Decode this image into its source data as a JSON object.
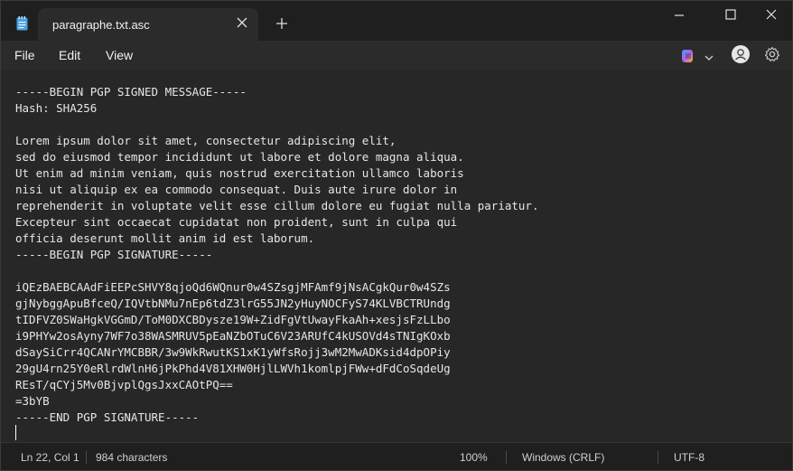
{
  "tab": {
    "title": "paragraphe.txt.asc"
  },
  "menu": {
    "file": "File",
    "edit": "Edit",
    "view": "View"
  },
  "editor": {
    "lines": [
      "-----BEGIN PGP SIGNED MESSAGE-----",
      "Hash: SHA256",
      "",
      "Lorem ipsum dolor sit amet, consectetur adipiscing elit,",
      "sed do eiusmod tempor incididunt ut labore et dolore magna aliqua.",
      "Ut enim ad minim veniam, quis nostrud exercitation ullamco laboris",
      "nisi ut aliquip ex ea commodo consequat. Duis aute irure dolor in",
      "reprehenderit in voluptate velit esse cillum dolore eu fugiat nulla pariatur.",
      "Excepteur sint occaecat cupidatat non proident, sunt in culpa qui",
      "officia deserunt mollit anim id est laborum.",
      "-----BEGIN PGP SIGNATURE-----",
      "",
      "iQEzBAEBCAAdFiEEPcSHVY8qjoQd6WQnur0w4SZsgjMFAmf9jNsACgkQur0w4SZs",
      "gjNybggApuBfceQ/IQVtbNMu7nEp6tdZ3lrG55JN2yHuyNOCFyS74KLVBCTRUndg",
      "tIDFVZ0SWaHgkVGGmD/ToM0DXCBDysze19W+ZidFgVtUwayFkaAh+xesjsFzLLbo",
      "i9PHYw2osAyny7WF7o38WASMRUV5pEaNZbOTuC6V23ARUfC4kUSOVd4sTNIgKOxb",
      "dSaySiCrr4QCANrYMCBBR/3w9WkRwutKS1xK1yWfsRojj3wM2MwADKsid4dpOPiy",
      "29gU4rn25Y0eRlrdWlnH6jPkPhd4V81XHW0HjlLWVh1komlpjFWw+dFdCoSqdeUg",
      "REsT/qCYj5Mv0BjvplQgsJxxCAOtPQ==",
      "=3bYB",
      "-----END PGP SIGNATURE-----",
      ""
    ]
  },
  "status": {
    "position": "Ln 22, Col 1",
    "characters": "984 characters",
    "zoom": "100%",
    "line_ending": "Windows (CRLF)",
    "encoding": "UTF-8"
  },
  "icons": {
    "app": "notepad-icon",
    "tab_close": "close-icon",
    "new_tab": "plus-icon",
    "minimize": "minimize-icon",
    "maximize": "maximize-icon",
    "close": "close-icon",
    "copilot": "copilot-icon",
    "account": "account-icon",
    "settings": "gear-icon"
  },
  "colors": {
    "background": "#272727",
    "titlebar": "#1f1f1f",
    "text": "#e6e6e6"
  }
}
